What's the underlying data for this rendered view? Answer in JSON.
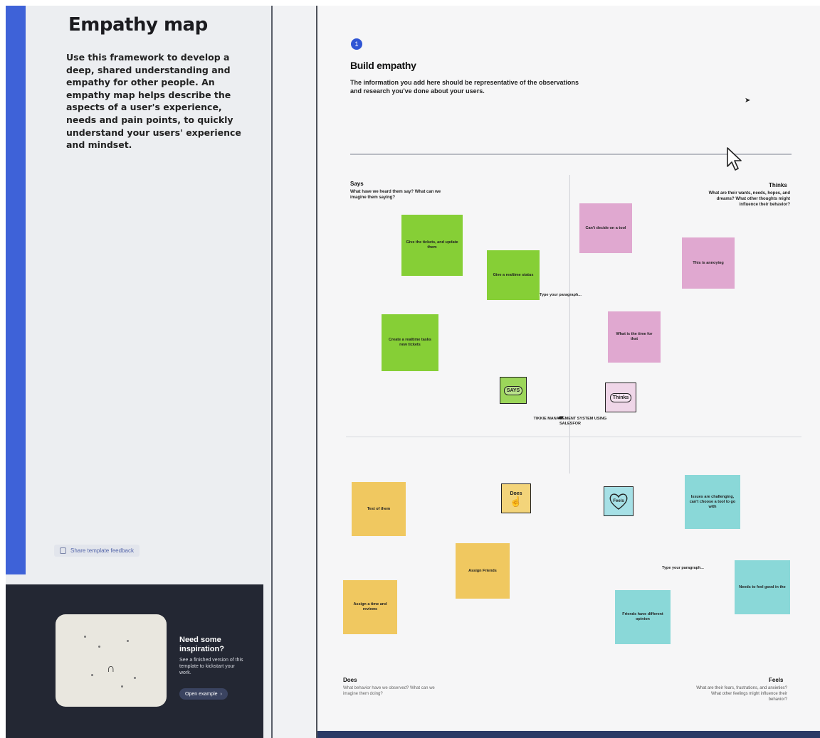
{
  "left_panel": {
    "title": "Empathy map",
    "description": "Use this framework to develop a deep, shared understanding and empathy for other people. An empathy map helps describe the aspects of a user's experience, needs and pain points, to quickly understand your users' experience and mindset.",
    "feedback_link": "Share template feedback",
    "inspiration": {
      "title": "Need some inspiration?",
      "description": "See a finished version of this template to kickstart your work.",
      "button_label": "Open example"
    }
  },
  "board": {
    "step_number": "1",
    "title": "Build empathy",
    "description": "The information you add here should be representative of the observations and research you've done about your users.",
    "quadrants": {
      "says": {
        "title": "Says",
        "subtitle": "What have we heard them say? What can we imagine them saying?"
      },
      "thinks": {
        "title": "Thinks",
        "subtitle": "What are their wants, needs, hopes, and dreams? What other thoughts might influence their behavior?"
      },
      "does": {
        "title": "Does",
        "subtitle": "What behavior have we observed? What can we imagine them doing?"
      },
      "feels": {
        "title": "Feels",
        "subtitle": "What are their fears, frustrations, and anxieties? What other feelings might influence their behavior?"
      }
    },
    "tags": {
      "says": "SAYS",
      "thinks": "Thinks",
      "does": "Does",
      "feels": "Feels"
    },
    "center_label": "TIKKIE MANAGEMENT SYSTEM USING SALESFOR",
    "notes": {
      "says_1": "Give the tickets, and update them",
      "says_2": "Give a realtime status",
      "says_3": "Create a realtime tasks new tickets",
      "thinks_1": "Can't decide on a tool",
      "thinks_2": "This is annoying",
      "thinks_3": "What is the time for that",
      "does_1": "Test of them",
      "does_2": "Assign Friends",
      "does_3": "Assign a time and reviews",
      "feels_1": "Issues are challenging, can't choose a tool to go with",
      "feels_2": "Friends have different opinion",
      "feels_3": "Needs to feel good in the"
    },
    "floating_texts": {
      "paragraph_1": "Type your paragraph...",
      "paragraph_2": "Type your paragraph..."
    }
  },
  "icons": [
    "step-badge",
    "cursor-arrow-icon",
    "heart-icon",
    "hand-pointer-icon",
    "thought-bubble-icon",
    "chat-icon"
  ],
  "colors": {
    "accent": "#3e62d8",
    "says_note": "#86cf36",
    "thinks_note": "#e0a8d0",
    "does_note": "#f0c860",
    "feels_note": "#8ad8d8"
  }
}
